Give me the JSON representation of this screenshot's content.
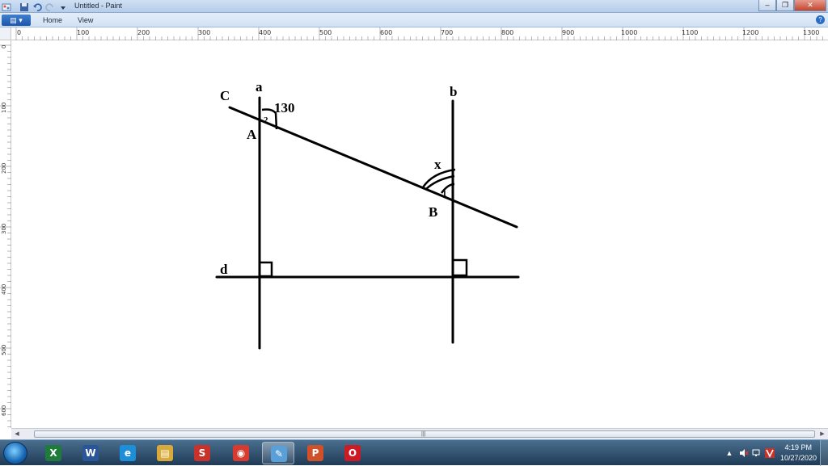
{
  "window": {
    "title": "Untitled - Paint",
    "minimize_glyph": "–",
    "maximize_glyph": "❐",
    "close_glyph": "✕"
  },
  "ribbon": {
    "paint_menu_glyph": "▤ ▾",
    "tabs": [
      {
        "label": "Home"
      },
      {
        "label": "View"
      }
    ],
    "help_glyph": "?"
  },
  "ruler": {
    "h_labels": [
      "0",
      "100",
      "200",
      "300",
      "400",
      "500",
      "600",
      "700",
      "800",
      "900",
      "1000",
      "1100",
      "1200",
      "1300"
    ],
    "v_labels": [
      "0",
      "100",
      "200",
      "300",
      "400",
      "500",
      "600"
    ]
  },
  "drawing": {
    "labels": {
      "a": "a",
      "b": "b",
      "c": "C",
      "d": "d",
      "point_a": "A",
      "point_b": "B",
      "angle_value": "130",
      "angle_x": "x",
      "angle_marker_2": "2",
      "angle_marker_1": "1"
    },
    "stroke_color": "#000000"
  },
  "scrollbar": {
    "left_arrow": "◀",
    "right_arrow": "▶",
    "grip": "|||"
  },
  "taskbar": {
    "apps": [
      {
        "name": "Excel",
        "glyph": "X",
        "color": "#1e7b3a"
      },
      {
        "name": "Word",
        "glyph": "W",
        "color": "#2a5699"
      },
      {
        "name": "Internet Explorer",
        "glyph": "e",
        "color": "#1d8fd8"
      },
      {
        "name": "File Explorer",
        "glyph": "▤",
        "color": "#d9a93a"
      },
      {
        "name": "Snagit",
        "glyph": "S",
        "color": "#c8322a"
      },
      {
        "name": "Chrome",
        "glyph": "◉",
        "color": "#d93a2f"
      },
      {
        "name": "Paint",
        "glyph": "✎",
        "color": "#5aa0d8"
      },
      {
        "name": "PowerPoint",
        "glyph": "P",
        "color": "#d0502a"
      },
      {
        "name": "Opera",
        "glyph": "O",
        "color": "#cc1b25"
      }
    ],
    "tray": {
      "up_arrow": "▲",
      "time": "4:19 PM",
      "date": "10/27/2020"
    }
  }
}
